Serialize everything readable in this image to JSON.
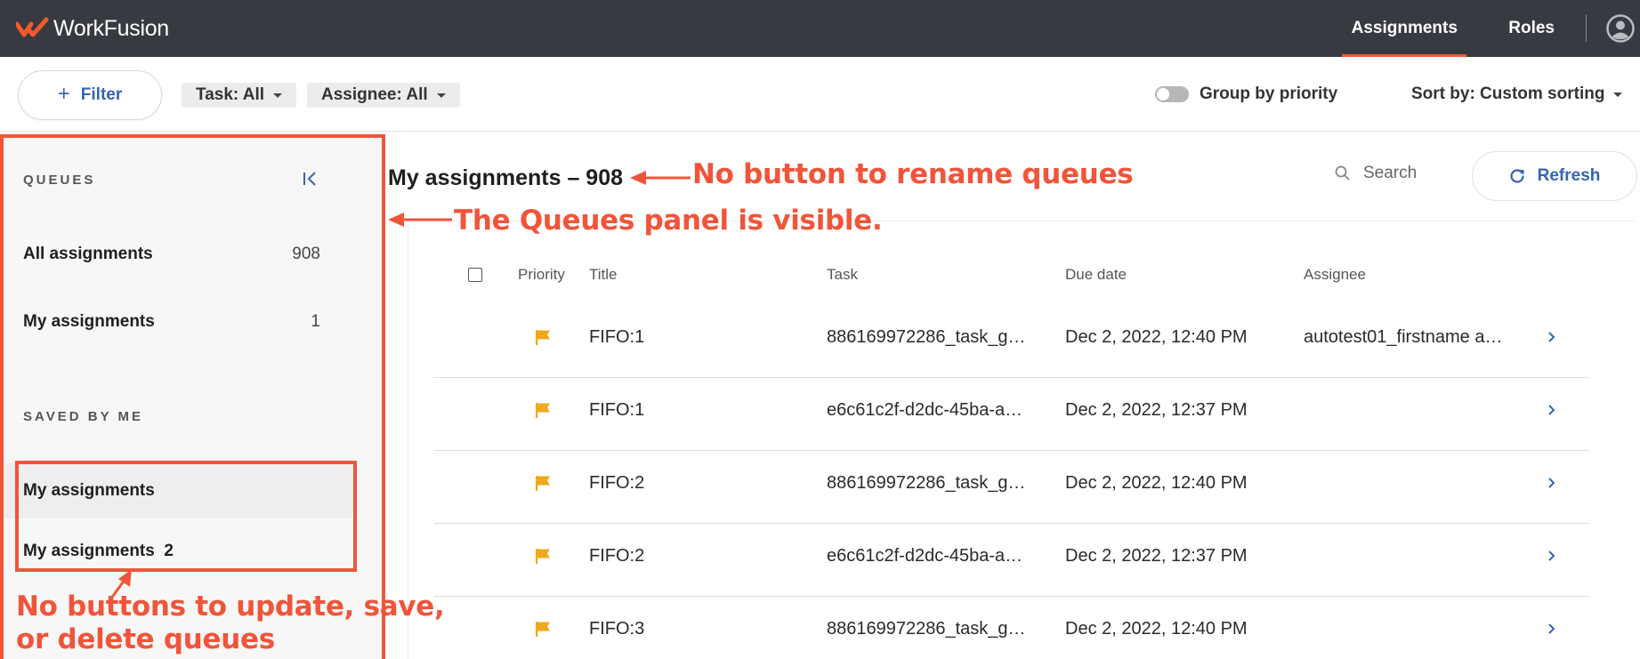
{
  "app": {
    "brand": "WorkFusion"
  },
  "nav": {
    "tabs": [
      "Assignments",
      "Roles"
    ],
    "active": "Assignments"
  },
  "filterbar": {
    "filter_label": "Filter",
    "chips": [
      "Task: All",
      "Assignee: All"
    ],
    "group_by_label": "Group by priority",
    "group_by_on": false,
    "sort_label": "Sort by: Custom sorting"
  },
  "sidebar": {
    "queues_heading": "QUEUES",
    "items": [
      {
        "label": "All assignments",
        "count": "908"
      },
      {
        "label": "My assignments",
        "count": "1"
      }
    ],
    "saved_heading": "SAVED BY ME",
    "saved_items": [
      {
        "label": "My assignments"
      },
      {
        "label": "My assignments  2"
      }
    ]
  },
  "main": {
    "title": "My assignments – 908",
    "search_placeholder": "Search",
    "refresh_label": "Refresh"
  },
  "table": {
    "columns": [
      "Priority",
      "Title",
      "Task",
      "Due date",
      "Assignee"
    ],
    "rows": [
      {
        "title": "FIFO:1",
        "task": "886169972286_task_g…",
        "due": "Dec 2, 2022, 12:40 PM",
        "assignee": "autotest01_firstname a…"
      },
      {
        "title": "FIFO:1",
        "task": "e6c61c2f-d2dc-45ba-a…",
        "due": "Dec 2, 2022, 12:37 PM",
        "assignee": ""
      },
      {
        "title": "FIFO:2",
        "task": "886169972286_task_g…",
        "due": "Dec 2, 2022, 12:40 PM",
        "assignee": ""
      },
      {
        "title": "FIFO:2",
        "task": "e6c61c2f-d2dc-45ba-a…",
        "due": "Dec 2, 2022, 12:37 PM",
        "assignee": ""
      },
      {
        "title": "FIFO:3",
        "task": "886169972286_task_g…",
        "due": "Dec 2, 2022, 12:40 PM",
        "assignee": ""
      }
    ]
  },
  "annotations": {
    "rename": "No button to rename queues",
    "panel": "The Queues panel is visible.",
    "buttons_line1": "No buttons to update, save,",
    "buttons_line2": "or delete queues"
  },
  "colors": {
    "topbar": "#373a40",
    "accent": "#f45a2a",
    "link": "#3664b0",
    "flag": "#f0a81c",
    "annotation": "#f0553a"
  },
  "icons": [
    "workfusion-logo-icon",
    "user-avatar-icon",
    "plus-icon",
    "caret-down-icon",
    "collapse-panel-icon",
    "search-icon",
    "refresh-icon",
    "flag-icon",
    "chevron-right-icon"
  ]
}
